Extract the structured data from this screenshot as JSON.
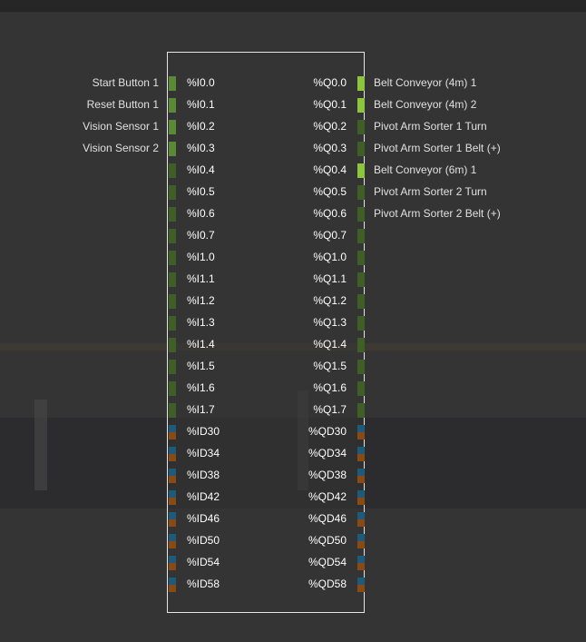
{
  "rows": [
    {
      "in_label": "Start Button 1",
      "in_addr": "%I0.0",
      "in_led": "dig-in-on",
      "out_addr": "%Q0.0",
      "out_led": "dig-out-on",
      "out_label": "Belt Conveyor (4m) 1"
    },
    {
      "in_label": "Reset Button 1",
      "in_addr": "%I0.1",
      "in_led": "dig-in-on",
      "out_addr": "%Q0.1",
      "out_led": "dig-out-on",
      "out_label": "Belt Conveyor (4m) 2"
    },
    {
      "in_label": "Vision Sensor 1",
      "in_addr": "%I0.2",
      "in_led": "dig-in-on",
      "out_addr": "%Q0.2",
      "out_led": "dig-off",
      "out_label": "Pivot Arm Sorter 1 Turn"
    },
    {
      "in_label": "Vision Sensor 2",
      "in_addr": "%I0.3",
      "in_led": "dig-in-on",
      "out_addr": "%Q0.3",
      "out_led": "dig-off",
      "out_label": "Pivot Arm Sorter 1 Belt (+)"
    },
    {
      "in_label": "",
      "in_addr": "%I0.4",
      "in_led": "dig-off",
      "out_addr": "%Q0.4",
      "out_led": "dig-out-on",
      "out_label": "Belt Conveyor (6m) 1"
    },
    {
      "in_label": "",
      "in_addr": "%I0.5",
      "in_led": "dig-off",
      "out_addr": "%Q0.5",
      "out_led": "dig-off",
      "out_label": "Pivot Arm Sorter 2 Turn"
    },
    {
      "in_label": "",
      "in_addr": "%I0.6",
      "in_led": "dig-off",
      "out_addr": "%Q0.6",
      "out_led": "dig-off",
      "out_label": "Pivot Arm Sorter 2 Belt (+)"
    },
    {
      "in_label": "",
      "in_addr": "%I0.7",
      "in_led": "dig-off",
      "out_addr": "%Q0.7",
      "out_led": "dig-off",
      "out_label": ""
    },
    {
      "in_label": "",
      "in_addr": "%I1.0",
      "in_led": "dig-off",
      "out_addr": "%Q1.0",
      "out_led": "dig-off",
      "out_label": ""
    },
    {
      "in_label": "",
      "in_addr": "%I1.1",
      "in_led": "dig-off",
      "out_addr": "%Q1.1",
      "out_led": "dig-off",
      "out_label": ""
    },
    {
      "in_label": "",
      "in_addr": "%I1.2",
      "in_led": "dig-off",
      "out_addr": "%Q1.2",
      "out_led": "dig-off",
      "out_label": ""
    },
    {
      "in_label": "",
      "in_addr": "%I1.3",
      "in_led": "dig-off",
      "out_addr": "%Q1.3",
      "out_led": "dig-off",
      "out_label": ""
    },
    {
      "in_label": "",
      "in_addr": "%I1.4",
      "in_led": "dig-off",
      "out_addr": "%Q1.4",
      "out_led": "dig-off",
      "out_label": ""
    },
    {
      "in_label": "",
      "in_addr": "%I1.5",
      "in_led": "dig-off",
      "out_addr": "%Q1.5",
      "out_led": "dig-off",
      "out_label": ""
    },
    {
      "in_label": "",
      "in_addr": "%I1.6",
      "in_led": "dig-off",
      "out_addr": "%Q1.6",
      "out_led": "dig-off",
      "out_label": ""
    },
    {
      "in_label": "",
      "in_addr": "%I1.7",
      "in_led": "dig-off",
      "out_addr": "%Q1.7",
      "out_led": "dig-off",
      "out_label": ""
    },
    {
      "in_label": "",
      "in_addr": "%ID30",
      "in_led": "ana",
      "out_addr": "%QD30",
      "out_led": "ana",
      "out_label": ""
    },
    {
      "in_label": "",
      "in_addr": "%ID34",
      "in_led": "ana",
      "out_addr": "%QD34",
      "out_led": "ana",
      "out_label": ""
    },
    {
      "in_label": "",
      "in_addr": "%ID38",
      "in_led": "ana",
      "out_addr": "%QD38",
      "out_led": "ana",
      "out_label": ""
    },
    {
      "in_label": "",
      "in_addr": "%ID42",
      "in_led": "ana",
      "out_addr": "%QD42",
      "out_led": "ana",
      "out_label": ""
    },
    {
      "in_label": "",
      "in_addr": "%ID46",
      "in_led": "ana",
      "out_addr": "%QD46",
      "out_led": "ana",
      "out_label": ""
    },
    {
      "in_label": "",
      "in_addr": "%ID50",
      "in_led": "ana",
      "out_addr": "%QD50",
      "out_led": "ana",
      "out_label": ""
    },
    {
      "in_label": "",
      "in_addr": "%ID54",
      "in_led": "ana",
      "out_addr": "%QD54",
      "out_led": "ana",
      "out_label": ""
    },
    {
      "in_label": "",
      "in_addr": "%ID58",
      "in_led": "ana",
      "out_addr": "%QD58",
      "out_led": "ana",
      "out_label": ""
    }
  ]
}
